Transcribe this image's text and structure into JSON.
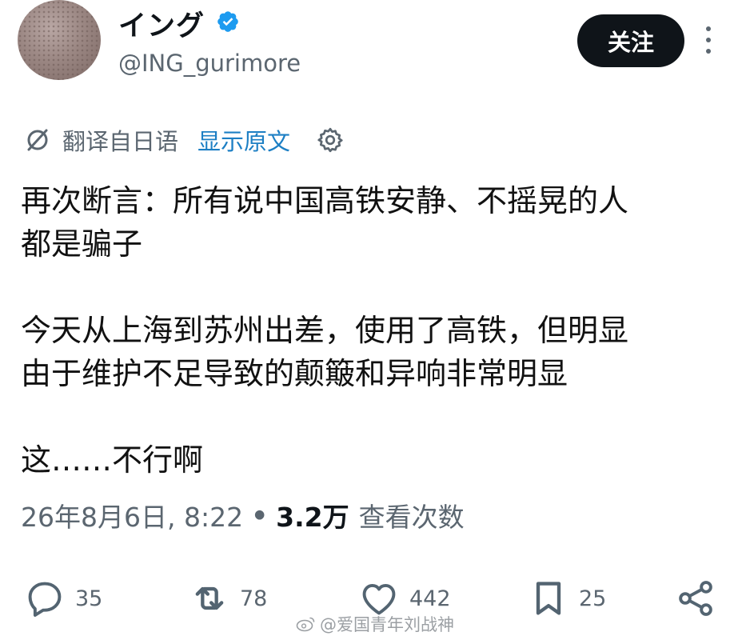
{
  "profile": {
    "display_name": "イング",
    "handle": "@ING_gurimore",
    "follow_label": "关注"
  },
  "translation": {
    "label": "翻译自日语",
    "show_original": "显示原文"
  },
  "tweet": {
    "text": "再次断言：所有说中国高铁安静、不摇晃的人\n都是骗子\n\n今天从上海到苏州出差，使用了高铁，但明显\n由于维护不足导致的颠簸和异响非常明显\n\n这……不行啊"
  },
  "meta": {
    "date": "26年8月6日, 8:22",
    "separator": "•",
    "views_count": "3.2万",
    "views_label": "查看次数"
  },
  "actions": {
    "reply_count": "35",
    "retweet_count": "78",
    "like_count": "442",
    "bookmark_count": "25"
  },
  "watermark": {
    "text": "@爱国青年刘战神"
  },
  "colors": {
    "verified": "#1d9bf0",
    "link": "#1d7fc4",
    "muted": "#5b6670",
    "follow_bg": "#0f1419"
  },
  "icons": [
    "verified-badge-icon",
    "more-icon",
    "translate-icon",
    "gear-icon",
    "reply-icon",
    "retweet-icon",
    "like-icon",
    "bookmark-icon",
    "share-icon",
    "weibo-logo-icon"
  ]
}
